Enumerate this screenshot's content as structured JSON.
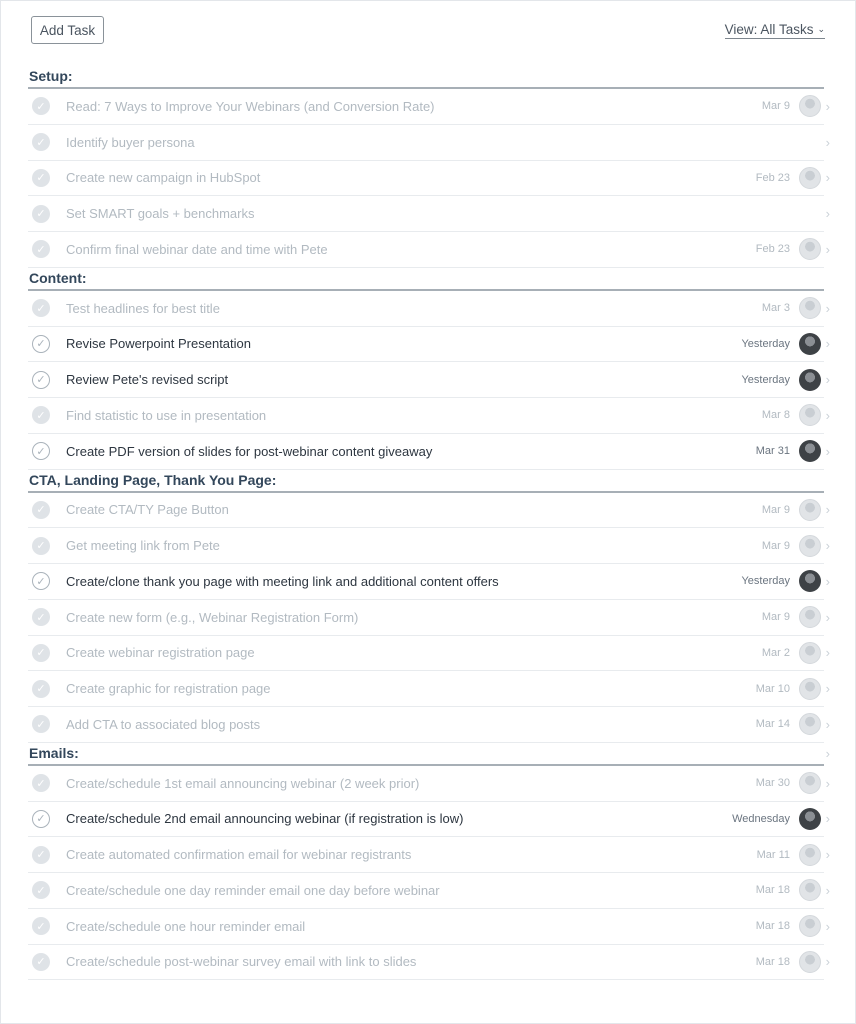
{
  "toolbar": {
    "add_task_label": "Add Task",
    "view_label": "View: All Tasks",
    "view_chevron": "⌄"
  },
  "sections": [
    {
      "title": "Setup:",
      "tasks": [
        {
          "name": "Read: 7 Ways to Improve Your Webinars (and Conversion Rate)",
          "due": "Mar 9",
          "completed": true,
          "avatar": "light"
        },
        {
          "name": "Identify buyer persona",
          "due": "",
          "completed": true,
          "avatar": ""
        },
        {
          "name": "Create new campaign in HubSpot",
          "due": "Feb 23",
          "completed": true,
          "avatar": "light"
        },
        {
          "name": "Set SMART goals + benchmarks",
          "due": "",
          "completed": true,
          "avatar": ""
        },
        {
          "name": "Confirm final webinar date and time with Pete",
          "due": "Feb 23",
          "completed": true,
          "avatar": "light"
        }
      ]
    },
    {
      "title": "Content:",
      "tasks": [
        {
          "name": "Test headlines for best title",
          "due": "Mar 3",
          "completed": true,
          "avatar": "light"
        },
        {
          "name": "Revise Powerpoint Presentation",
          "due": "Yesterday",
          "completed": false,
          "avatar": "dark"
        },
        {
          "name": "Review Pete's revised script",
          "due": "Yesterday",
          "completed": false,
          "avatar": "dark"
        },
        {
          "name": "Find statistic to use in presentation",
          "due": "Mar 8",
          "completed": true,
          "avatar": "light"
        },
        {
          "name": "Create PDF version of slides for post-webinar content giveaway",
          "due": "Mar 31",
          "completed": false,
          "avatar": "dark"
        }
      ]
    },
    {
      "title": "CTA, Landing Page, Thank You Page:",
      "tasks": [
        {
          "name": "Create CTA/TY Page Button",
          "due": "Mar 9",
          "completed": true,
          "avatar": "light"
        },
        {
          "name": "Get meeting link from Pete",
          "due": "Mar 9",
          "completed": true,
          "avatar": "light"
        },
        {
          "name": "Create/clone thank you page with meeting link and additional content offers",
          "due": "Yesterday",
          "completed": false,
          "avatar": "dark"
        },
        {
          "name": "Create new form (e.g., Webinar Registration Form)",
          "due": "Mar 9",
          "completed": true,
          "avatar": "light"
        },
        {
          "name": "Create webinar registration page",
          "due": "Mar 2",
          "completed": true,
          "avatar": "light"
        },
        {
          "name": "Create graphic for registration page",
          "due": "Mar 10",
          "completed": true,
          "avatar": "light"
        },
        {
          "name": "Add CTA to associated blog posts",
          "due": "Mar 14",
          "completed": true,
          "avatar": "light"
        }
      ]
    },
    {
      "title": "Emails:",
      "tasks": [
        {
          "name": "Create/schedule 1st email announcing webinar (2 week prior)",
          "due": "Mar 30",
          "completed": true,
          "avatar": "light"
        },
        {
          "name": "Create/schedule 2nd email announcing webinar (if registration is low)",
          "due": "Wednesday",
          "completed": false,
          "avatar": "dark"
        },
        {
          "name": "Create automated confirmation email for webinar registrants",
          "due": "Mar 11",
          "completed": true,
          "avatar": "light"
        },
        {
          "name": "Create/schedule one day reminder email one day before webinar",
          "due": "Mar 18",
          "completed": true,
          "avatar": "light"
        },
        {
          "name": "Create/schedule one hour reminder email",
          "due": "Mar 18",
          "completed": true,
          "avatar": "light"
        },
        {
          "name": "Create/schedule post-webinar survey email with link to slides",
          "due": "Mar 18",
          "completed": true,
          "avatar": "light"
        }
      ]
    }
  ],
  "icons": {
    "check": "✓",
    "chevron_right": "›"
  }
}
